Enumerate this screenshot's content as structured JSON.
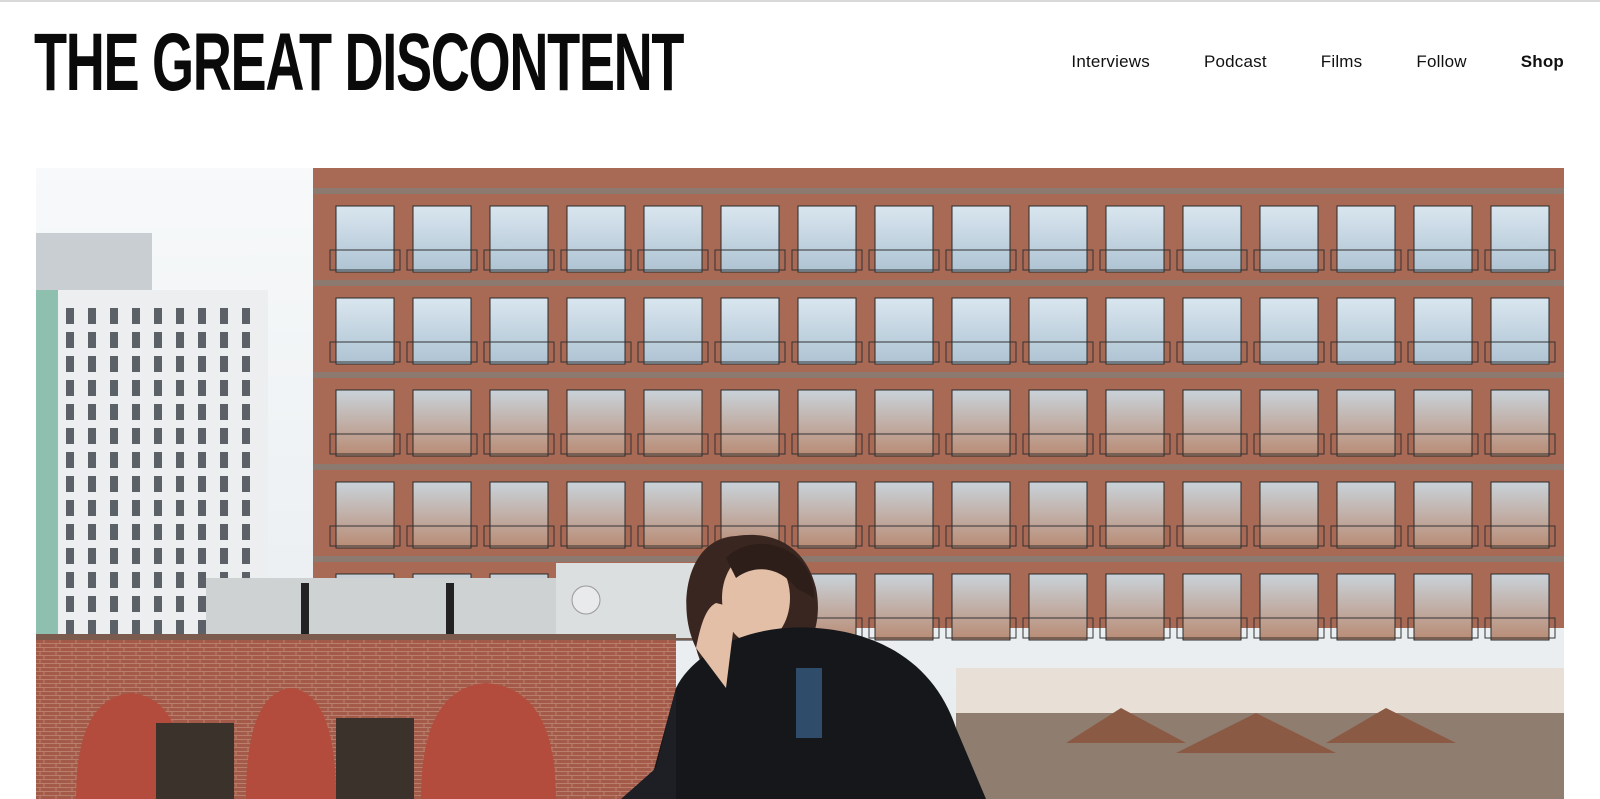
{
  "site": {
    "logo_text": "THE GREAT DISCONTENT"
  },
  "nav": {
    "items": [
      {
        "label": "Interviews",
        "active": false
      },
      {
        "label": "Podcast",
        "active": false
      },
      {
        "label": "Films",
        "active": false
      },
      {
        "label": "Follow",
        "active": false
      },
      {
        "label": "Shop",
        "active": true
      }
    ]
  },
  "hero": {
    "alt": "Woman in a dark coat sitting on a rooftop in front of a brick-and-glass apartment building",
    "colors": {
      "sky": "#f2f5f7",
      "brick": "#a86a54",
      "glass": "#c6d6e2",
      "coat": "#15171b"
    }
  }
}
